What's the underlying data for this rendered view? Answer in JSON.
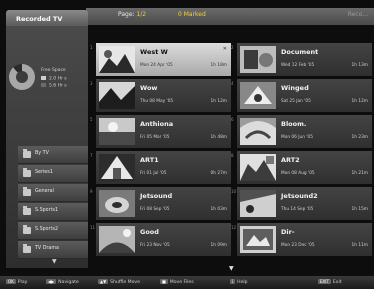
{
  "header": {
    "pages_label": "Page:",
    "pages_value": "1/2",
    "selected_label": "0 Marked",
    "right_text": "Reco..."
  },
  "sidebar": {
    "title": "Recorded TV",
    "free_space_label": "Free Space",
    "legend": [
      {
        "text": "2.0 Hr s",
        "color": "#cfcfcf"
      },
      {
        "text": "5.6 Hr s",
        "color": "#6b6b6b"
      }
    ],
    "folders": [
      {
        "label": "By TV"
      },
      {
        "label": "Series1"
      },
      {
        "label": "General"
      },
      {
        "label": "S.Sports1"
      },
      {
        "label": "S.Sports2"
      },
      {
        "label": "TV Drama"
      }
    ],
    "scroll_down": "▼"
  },
  "recordings": [
    {
      "number": "1",
      "title": "West W",
      "meta": "Mon 24 Apr '05",
      "duration": "1h 18m",
      "selected": true,
      "thumb": "a"
    },
    {
      "number": "2",
      "title": "Document",
      "meta": "Wed 12 Feb '05",
      "duration": "1h 13m",
      "selected": false,
      "thumb": "b"
    },
    {
      "number": "3",
      "title": "Wow",
      "meta": "Thu 08 May '05",
      "duration": "1h 12m",
      "selected": false,
      "thumb": "c"
    },
    {
      "number": "4",
      "title": "Winged",
      "meta": "Sat 25 Jan '05",
      "duration": "1h 12m",
      "selected": false,
      "thumb": "d"
    },
    {
      "number": "5",
      "title": "Anthiona",
      "meta": "Fri 05 Mar '05",
      "duration": "1h 48m",
      "selected": false,
      "thumb": "e"
    },
    {
      "number": "6",
      "title": "Bloom.",
      "meta": "Mon 06 Jun '05",
      "duration": "1h 23m",
      "selected": false,
      "thumb": "f"
    },
    {
      "number": "7",
      "title": "ART1",
      "meta": "Fri 01 Jul '05",
      "duration": "0h 27m",
      "selected": false,
      "thumb": "g"
    },
    {
      "number": "8",
      "title": "ART2",
      "meta": "Mon 08 Aug '05",
      "duration": "1h 21m",
      "selected": false,
      "thumb": "h"
    },
    {
      "number": "9",
      "title": "Jetsound",
      "meta": "Fri 08 Sep '05",
      "duration": "1h 03m",
      "selected": false,
      "thumb": "i"
    },
    {
      "number": "10",
      "title": "Jetsound2",
      "meta": "Thu 14 Sep '05",
      "duration": "1h 15m",
      "selected": false,
      "thumb": "j"
    },
    {
      "number": "11",
      "title": "Good",
      "meta": "Fri 23 Nov '05",
      "duration": "1h 09m",
      "selected": false,
      "thumb": "k"
    },
    {
      "number": "12",
      "title": "Dir-",
      "meta": "Mon 23 Dec '05",
      "duration": "1h 11m",
      "selected": false,
      "thumb": "l"
    }
  ],
  "grid_scroll": "▼",
  "footer": [
    {
      "key": "OK",
      "label": "Play"
    },
    {
      "key": "◀▶",
      "label": "Navigate"
    },
    {
      "key": "▲▼",
      "label": "Shuffle Move"
    },
    {
      "key": "■",
      "label": "Move Files"
    },
    {
      "key": "i",
      "label": "Help"
    },
    {
      "key": "EXIT",
      "label": "Exit"
    }
  ]
}
